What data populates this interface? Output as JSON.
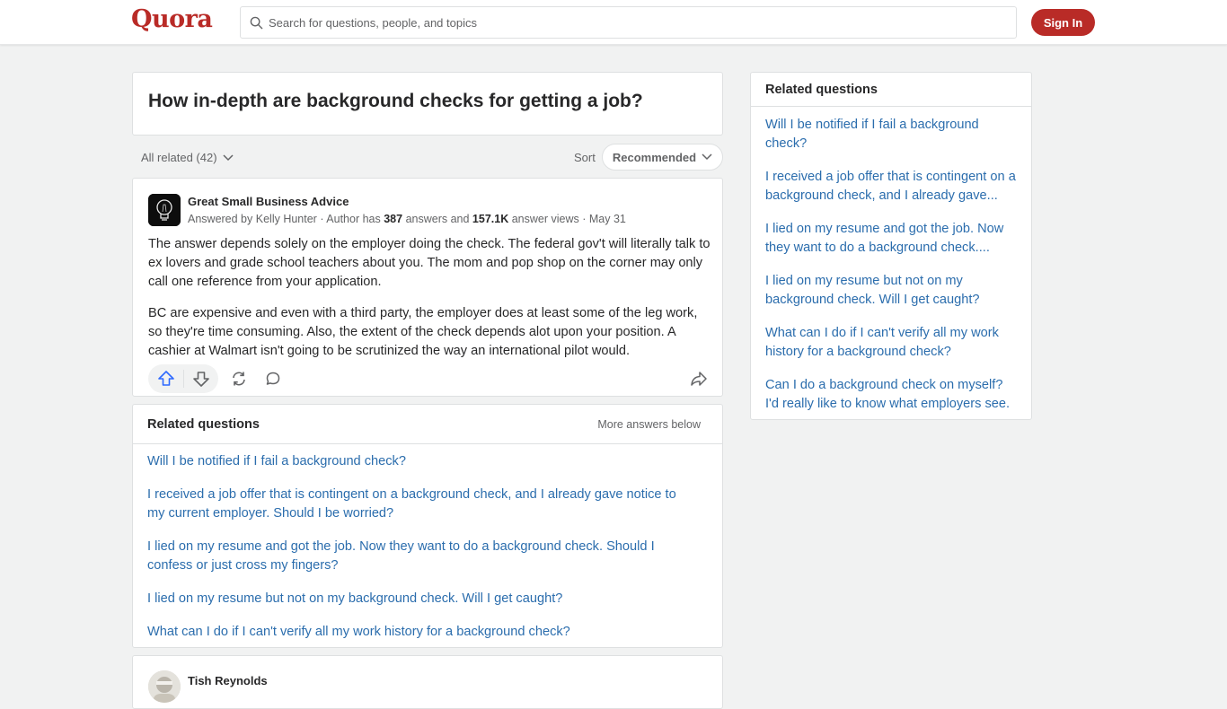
{
  "header": {
    "logo": "Quora",
    "search_placeholder": "Search for questions, people, and topics",
    "signin_label": "Sign In"
  },
  "question": {
    "title": "How in-depth are background checks for getting a job?"
  },
  "filters": {
    "all_related_label": "All related (42)",
    "sort_label": "Sort",
    "sort_value": "Recommended"
  },
  "answer": {
    "author": "Great Small Business Advice",
    "answered_by_prefix": "Answered by",
    "answered_by": "Kelly Hunter",
    "author_has_prefix": "· Author has",
    "answers_count": "387",
    "answers_and": "answers and",
    "answer_views": "157.1K",
    "answer_views_suffix": "answer views",
    "date": "· May 31",
    "paragraphs": [
      "The answer depends solely on the employer doing the check. The federal gov't will literally talk to ex lovers and grade school teachers about you. The mom and pop shop on the corner may only call one reference from your application.",
      "BC are expensive and even with a third party, the employer does at least some of the leg work, so they're time consuming. Also, the extent of the check depends alot upon your position. A cashier at Walmart isn't going to be scrutinized the way an international pilot would."
    ],
    "actions": {
      "upvote": "upvote-icon",
      "downvote": "downvote-icon",
      "share": "reshare-icon",
      "comment": "comment-icon",
      "forward": "share-icon"
    }
  },
  "related_inline": {
    "title": "Related questions",
    "more": "More answers below",
    "items": [
      "Will I be notified if I fail a background check?",
      "I received a job offer that is contingent on a background check, and I already gave notice to my current employer. Should I be worried?",
      "I lied on my resume and got the job. Now they want to do a background check. Should I confess or just cross my fingers?",
      "I lied on my resume but not on my background check. Will I get caught?",
      "What can I do if I can't verify all my work history for a background check?"
    ]
  },
  "next_answer": {
    "author": "Tish Reynolds"
  },
  "sidebar": {
    "title": "Related questions",
    "items": [
      "Will I be notified if I fail a background check?",
      "I received a job offer that is contingent on a background check, and I already gave...",
      "I lied on my resume and got the job. Now they want to do a background check....",
      "I lied on my resume but not on my background check. Will I get caught?",
      "What can I do if I can't verify all my work history for a background check?",
      "Can I do a background check on myself? I'd really like to know what employers see."
    ]
  },
  "colors": {
    "brand": "#b92b27",
    "link": "#2b6dad",
    "upvote": "#2e69ff"
  }
}
